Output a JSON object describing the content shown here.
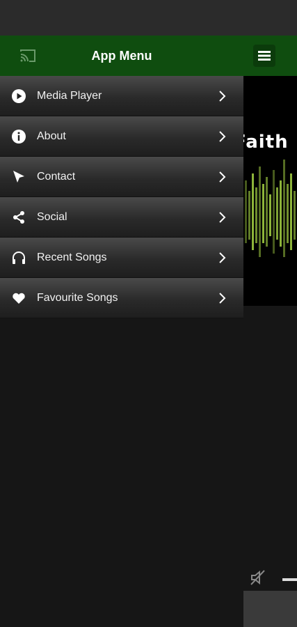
{
  "drawer": {
    "title": "App Menu",
    "items": [
      {
        "label": "Media Player",
        "icon": "play-circle-icon"
      },
      {
        "label": "About",
        "icon": "info-icon"
      },
      {
        "label": "Contact",
        "icon": "cursor-icon"
      },
      {
        "label": "Social",
        "icon": "share-icon"
      },
      {
        "label": "Recent Songs",
        "icon": "headphones-icon"
      },
      {
        "label": "Favourite Songs",
        "icon": "heart-icon"
      }
    ]
  },
  "background": {
    "hero_text": "Faith"
  },
  "colors": {
    "header_green": "#0f4d0f",
    "drawer_bg": "#161616",
    "eq_green": "#8db43a"
  }
}
